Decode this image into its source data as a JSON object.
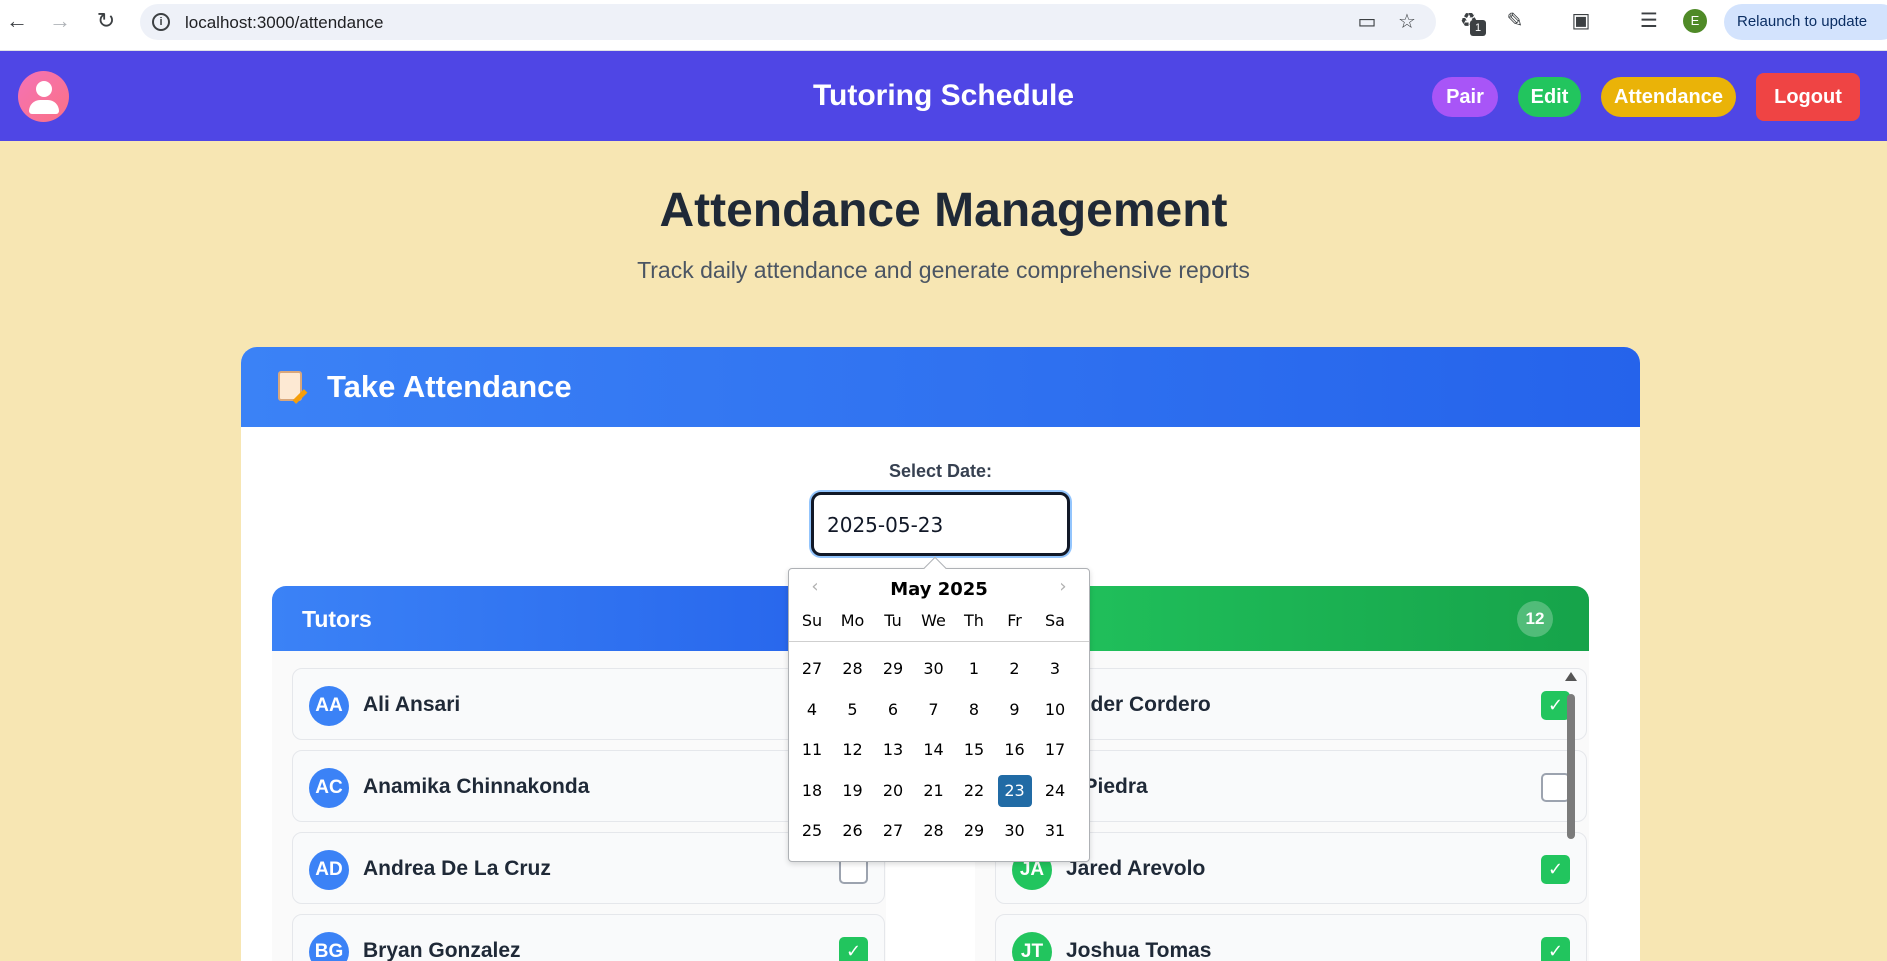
{
  "browser": {
    "url": "localhost:3000/attendance",
    "ext_badge": "1",
    "profile_initial": "E",
    "relaunch_label": "Relaunch to update"
  },
  "header": {
    "title": "Tutoring Schedule",
    "buttons": {
      "pair": "Pair",
      "edit": "Edit",
      "attendance": "Attendance",
      "logout": "Logout"
    }
  },
  "page": {
    "title": "Attendance Management",
    "subtitle": "Track daily attendance and generate comprehensive reports"
  },
  "card": {
    "title": "Take Attendance",
    "date_label": "Select Date:",
    "date_value": "2025-05-23"
  },
  "tutors": {
    "label": "Tutors",
    "rows": [
      {
        "initials": "AA",
        "name": "Ali Ansari",
        "checked": false
      },
      {
        "initials": "AC",
        "name": "Anamika Chinnakonda",
        "checked": false
      },
      {
        "initials": "AD",
        "name": "Andrea De La Cruz",
        "checked": false
      },
      {
        "initials": "BG",
        "name": "Bryan Gonzalez",
        "checked": true
      }
    ]
  },
  "students": {
    "count": "12",
    "rows": [
      {
        "initials": "",
        "name": "ander Cordero",
        "checked": true
      },
      {
        "initials": "",
        "name": "a Piedra",
        "checked": false
      },
      {
        "initials": "JA",
        "name": "Jared Arevolo",
        "checked": true
      },
      {
        "initials": "JT",
        "name": "Joshua Tomas",
        "checked": true
      }
    ]
  },
  "datepicker": {
    "month_label": "May 2025",
    "weekdays": [
      "Su",
      "Mo",
      "Tu",
      "We",
      "Th",
      "Fr",
      "Sa"
    ],
    "weeks": [
      [
        "27",
        "28",
        "29",
        "30",
        "1",
        "2",
        "3"
      ],
      [
        "4",
        "5",
        "6",
        "7",
        "8",
        "9",
        "10"
      ],
      [
        "11",
        "12",
        "13",
        "14",
        "15",
        "16",
        "17"
      ],
      [
        "18",
        "19",
        "20",
        "21",
        "22",
        "23",
        "24"
      ],
      [
        "25",
        "26",
        "27",
        "28",
        "29",
        "30",
        "31"
      ]
    ],
    "selected": "23"
  }
}
